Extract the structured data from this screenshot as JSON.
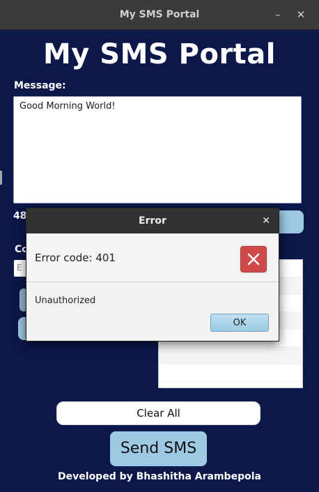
{
  "window": {
    "title": "My SMS Portal",
    "minimize": "–",
    "close": "✕"
  },
  "app": {
    "heading": "My SMS Portal",
    "message_label": "Message:",
    "message_value": "Good Morning World!",
    "char_count": "48",
    "contact_label": "Co",
    "contact_placeholder": "E",
    "clear_all": "Clear All",
    "send_sms": "Send SMS",
    "footer": "Developed by Bhashitha Arambepola"
  },
  "dialog": {
    "title": "Error",
    "close": "✕",
    "header": "Error code: 401",
    "content": "Unauthorized",
    "ok": "OK"
  },
  "colors": {
    "background": "#0c174a",
    "accent": "#9ec9e3",
    "error": "#cf4b4b"
  },
  "icons": {
    "error": "close-x-icon"
  }
}
